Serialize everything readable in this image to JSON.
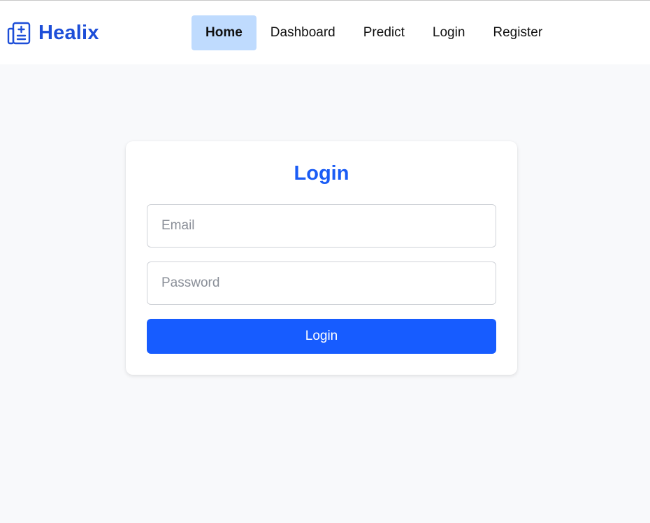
{
  "brand": {
    "name": "Healix",
    "icon": "hospital-icon",
    "color": "#1d4ed8"
  },
  "nav": {
    "items": [
      {
        "label": "Home",
        "active": true
      },
      {
        "label": "Dashboard",
        "active": false
      },
      {
        "label": "Predict",
        "active": false
      },
      {
        "label": "Login",
        "active": false
      },
      {
        "label": "Register",
        "active": false
      }
    ],
    "active_bg": "#bfdbfe"
  },
  "login_form": {
    "title": "Login",
    "email": {
      "value": "",
      "placeholder": "Email"
    },
    "password": {
      "value": "",
      "placeholder": "Password"
    },
    "submit_label": "Login",
    "accent": "#175cff"
  }
}
